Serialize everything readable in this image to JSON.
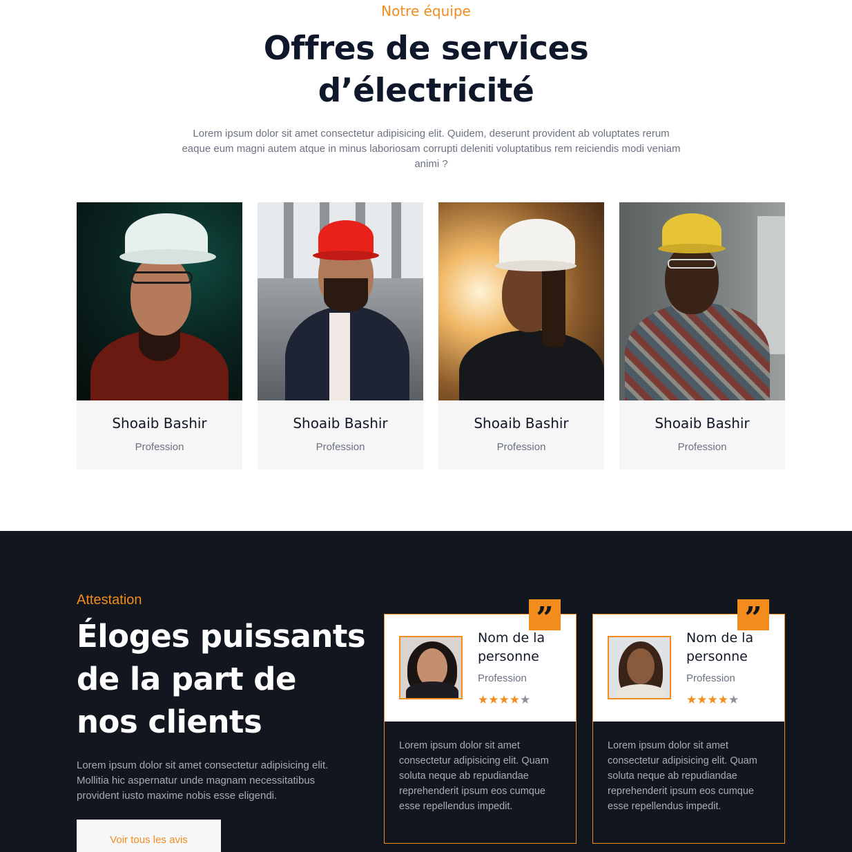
{
  "team": {
    "eyebrow": "Notre équipe",
    "title_line1": "Offres de services",
    "title_line2": "d’électricité",
    "description": "Lorem ipsum dolor sit amet consectetur adipisicing elit. Quidem, deserunt provident ab voluptates rerum eaque eum magni autem atque in minus laboriosam corrupti deleniti voluptatibus rem reiciendis modi veniam animi ?",
    "members": [
      {
        "name": "Shoaib Bashir",
        "role": "Profession",
        "hat_color": "#e6f1ee"
      },
      {
        "name": "Shoaib Bashir",
        "role": "Profession",
        "hat_color": "#e8221b"
      },
      {
        "name": "Shoaib Bashir",
        "role": "Profession",
        "hat_color": "#f3f2ee"
      },
      {
        "name": "Shoaib Bashir",
        "role": "Profession",
        "hat_color": "#e7c436"
      }
    ]
  },
  "testimonials": {
    "eyebrow": "Attestation",
    "title": "Éloges puissants de la part de nos clients",
    "description": "Lorem ipsum dolor sit amet consectetur adipisicing elit. Mollitia hic aspernatur unde magnam necessitatibus provident iusto maxime nobis esse eligendi.",
    "button_label": "Voir tous les avis",
    "items": [
      {
        "name": "Nom de la personne",
        "role": "Profession",
        "rating": 4,
        "max_rating": 5,
        "quote_icon": "quote-icon",
        "text": "Lorem ipsum dolor sit amet consectetur adipisicing elit. Quam soluta neque ab repudiandae reprehenderit ipsum eos cumque esse repellendus impedit."
      },
      {
        "name": "Nom de la personne",
        "role": "Profession",
        "rating": 4,
        "max_rating": 5,
        "quote_icon": "quote-icon",
        "text": "Lorem ipsum dolor sit amet consectetur adipisicing elit. Quam soluta neque ab repudiandae reprehenderit ipsum eos cumque esse repellendus impedit."
      }
    ]
  },
  "colors": {
    "accent": "#f28c1c",
    "dark": "#12161f",
    "card_bg": "#f6f6f7"
  }
}
